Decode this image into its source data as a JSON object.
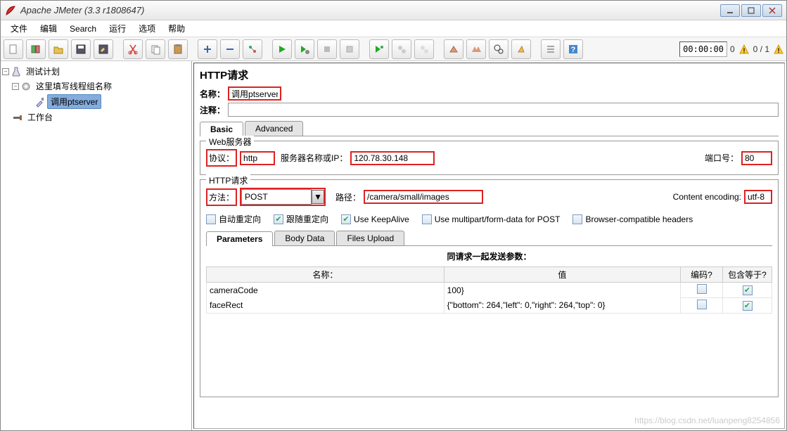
{
  "window": {
    "title": "Apache JMeter (3.3 r1808647)"
  },
  "menu": {
    "items": [
      "文件",
      "编辑",
      "Search",
      "运行",
      "选项",
      "帮助"
    ]
  },
  "toolbar": {
    "timer": "00:00:00",
    "warn1": "0",
    "threads": "0 / 1"
  },
  "tree": {
    "plan": "测试计划",
    "threadGroup": "这里填写线程组名称",
    "sampler": "调用ptserver",
    "workbench": "工作台"
  },
  "panel": {
    "title": "HTTP请求",
    "name_lbl": "名称：",
    "name": "调用ptserver",
    "comment_lbl": "注释：",
    "comment": "",
    "tabs": {
      "basic": "Basic",
      "advanced": "Advanced"
    },
    "webserver": {
      "legend": "Web服务器",
      "proto_lbl": "协议：",
      "proto": "http",
      "host_lbl": "服务器名称或IP：",
      "host": "120.78.30.148",
      "port_lbl": "端口号：",
      "port": "80"
    },
    "request": {
      "legend": "HTTP请求",
      "method_lbl": "方法：",
      "method": "POST",
      "path_lbl": "路径：",
      "path": "/camera/small/images",
      "enc_lbl": "Content encoding:",
      "enc": "utf-8"
    },
    "checks": {
      "auto": "自动重定向",
      "follow": "跟随重定向",
      "keep": "Use KeepAlive",
      "multi": "Use multipart/form-data for POST",
      "browser": "Browser-compatible headers"
    },
    "subtabs": {
      "params": "Parameters",
      "body": "Body Data",
      "files": "Files Upload"
    },
    "ptitle": "同请求一起发送参数：",
    "cols": {
      "name": "名称：",
      "val": "值",
      "enc": "编码?",
      "eq": "包含等于?"
    },
    "rows": [
      {
        "name": "cameraCode",
        "val": "100}",
        "enc": false,
        "eq": true
      },
      {
        "name": "faceRect",
        "val": "{\"bottom\": 264,\"left\": 0,\"right\": 264,\"top\": 0}",
        "enc": false,
        "eq": true
      }
    ]
  },
  "watermark": "https://blog.csdn.net/luanpeng8254856"
}
